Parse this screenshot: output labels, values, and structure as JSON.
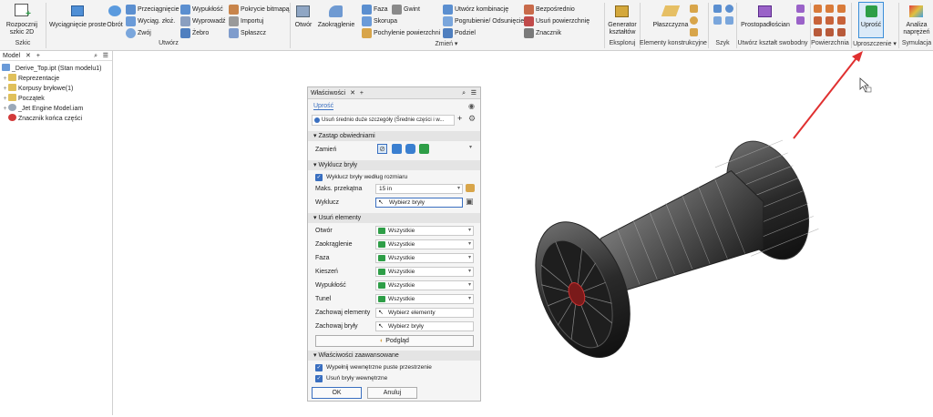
{
  "ribbon": {
    "groups": {
      "szkic": "Szkic",
      "utworz": "Utwórz",
      "zmien": "Zmień ▾",
      "eksploruj": "Eksploruj",
      "elementy": "Elementy konstrukcyjne",
      "szyk": "Szyk",
      "swobodny": "Utwórz kształt swobodny",
      "powierzchnia": "Powierzchnia",
      "uproszczenie": "Uproszczenie ▾",
      "symulacja": "Symulacja"
    },
    "buttons": {
      "rozpocznij_1": "Rozpocznij",
      "rozpocznij_2": "szkic 2D",
      "wyciagniecie": "Wyciągnięcie proste",
      "obrot": "Obrót",
      "przeciagniecie": "Przeciągnięcie",
      "wyciag_zloz": "Wyciąg. złoż.",
      "zwoj": "Zwój",
      "wypuklosc": "Wypukłość",
      "wyprowadz": "Wyprowadź",
      "zebro": "Żebro",
      "pokrycie": "Pokrycie bitmapą",
      "importuj": "Importuj",
      "splaszcz": "Spłaszcz",
      "otwor": "Otwór",
      "zaokraglenie": "Zaokrąglenie",
      "faza": "Faza",
      "gwint": "Gwint",
      "skorupa": "Skorupa",
      "pochylenie": "Pochylenie powierzchni",
      "utworz_komb": "Utwórz kombinację",
      "pogrubienie": "Pogrubienie/ Odsunięcie",
      "podziel": "Podziel",
      "bezposrednio": "Bezpośrednio",
      "usun_pow": "Usuń powierzchnię",
      "znacznik": "Znacznik",
      "generator_1": "Generator",
      "generator_2": "kształtów",
      "plaszczyzna": "Płaszczyzna",
      "prostopadloscian": "Prostopadłościan",
      "uprosc": "Uprość",
      "analiza_1": "Analiza",
      "analiza_2": "naprężeń"
    }
  },
  "browser": {
    "tab": "Model",
    "items": [
      "_Derive_Top.ipt (Stan modelu1)",
      "Reprezentacje",
      "Korpusy bryłowe(1)",
      "Początek",
      "_Jet Engine Model.iam",
      "Znacznik końca części"
    ]
  },
  "panel": {
    "title": "Właściwości",
    "tab": "Uprość",
    "preset": "Usuń średnio duże szczegóły (Średnie części i w...",
    "sections": {
      "replace": "Zastąp obwiedniami",
      "exclude": "Wyklucz bryły",
      "remove": "Usuń elementy",
      "advanced": "Właściwości zaawansowane"
    },
    "replace_label": "Zamień",
    "exclude_by_size": "Wyklucz bryły według rozmiaru",
    "max_diag_label": "Maks. przekątna",
    "max_diag_value": "15 in",
    "exclude_label": "Wyklucz",
    "select_bodies": "Wybierz bryły",
    "features": [
      {
        "label": "Otwór",
        "value": "Wszystkie"
      },
      {
        "label": "Zaokrąglenie",
        "value": "Wszystkie"
      },
      {
        "label": "Faza",
        "value": "Wszystkie"
      },
      {
        "label": "Kieszeń",
        "value": "Wszystkie"
      },
      {
        "label": "Wypukłość",
        "value": "Wszystkie"
      },
      {
        "label": "Tunel",
        "value": "Wszystkie"
      }
    ],
    "keep_features_label": "Zachowaj elementy",
    "keep_features_value": "Wybierz elementy",
    "keep_bodies_label": "Zachowaj bryły",
    "keep_bodies_value": "Wybierz bryły",
    "preview": "Podgląd",
    "fill_voids": "Wypełnij wewnętrzne puste przestrzenie",
    "remove_internal": "Usuń bryły wewnętrzne",
    "ok": "OK",
    "cancel": "Anuluj"
  },
  "colors": {
    "accent": "#3a6fc0",
    "arrow": "#e03030",
    "green": "#2e9e47"
  }
}
